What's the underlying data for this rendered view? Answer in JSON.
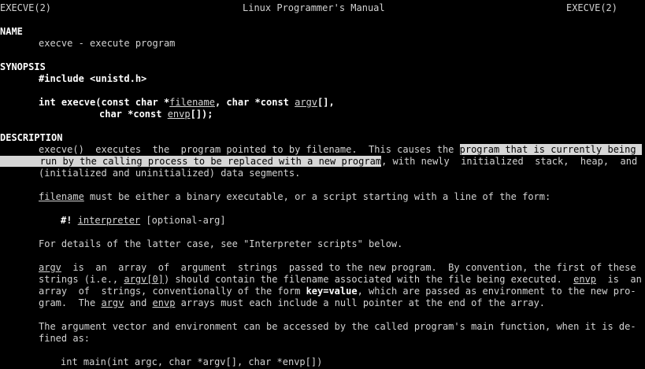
{
  "header": {
    "left": "EXECVE(2)",
    "center": "Linux Programmer's Manual",
    "right": "EXECVE(2)"
  },
  "name_section": {
    "heading": "NAME",
    "text": "execve - execute program"
  },
  "synopsis": {
    "heading": "SYNOPSIS",
    "include": "#include <unistd.h>",
    "proto_1": "int execve(const char *",
    "proto_arg1": "filename",
    "proto_2": ", char *const ",
    "proto_arg2": "argv",
    "proto_3": "[],",
    "proto_4": "char *const ",
    "proto_arg3": "envp",
    "proto_5": "[]);"
  },
  "description": {
    "heading": "DESCRIPTION",
    "p1_l1_pre": "execve()  executes  the  program pointed to by filename.  This causes the ",
    "p1_l1_hl": "program that is currently being ",
    "p1_l2_hl": "run by the calling process to be replaced with a new program",
    "p1_l2_post": ", with newly  initialized  stack,  heap,  and",
    "p1_l3": "(initialized and uninitialized) data segments.",
    "p2_arg": "filename",
    "p2_text": " must be either a binary executable, or a script starting with a line of the form:",
    "p3_pre": "#! ",
    "p3_arg": "interpreter",
    "p3_post": " [optional-arg]",
    "p4": "For details of the latter case, see \"Interpreter scripts\" below.",
    "p5_l1_arg": "argv",
    "p5_l1_text": "  is  an  array  of  argument  strings  passed to the new program.  By convention, the first of these",
    "p5_l2_pre": "strings (i.e., ",
    "p5_l2_arg": "argv[0]",
    "p5_l2_mid": ") should contain the filename associated with the file being executed.  ",
    "p5_l2_arg2": "envp",
    "p5_l2_post": "  is  an",
    "p5_l3_pre": "array  of  strings, conventionally of the form ",
    "p5_l3_bold": "key=value",
    "p5_l3_post": ", which are passed as environment to the new pro-",
    "p5_l4_pre": "gram.  The ",
    "p5_l4_arg1": "argv",
    "p5_l4_mid": " and ",
    "p5_l4_arg2": "envp",
    "p5_l4_post": " arrays must each include a null pointer at the end of the array.",
    "p6_l1": "The argument vector and environment can be accessed by the called program's main function, when it is de-",
    "p6_l2": "fined as:",
    "p7": "int main(int argc, char *argv[], char *envp[])"
  },
  "colors": {
    "background": "#000000",
    "text": "#d3d3d3",
    "highlight_bg": "#d6d6d6",
    "highlight_fg": "#000000"
  }
}
